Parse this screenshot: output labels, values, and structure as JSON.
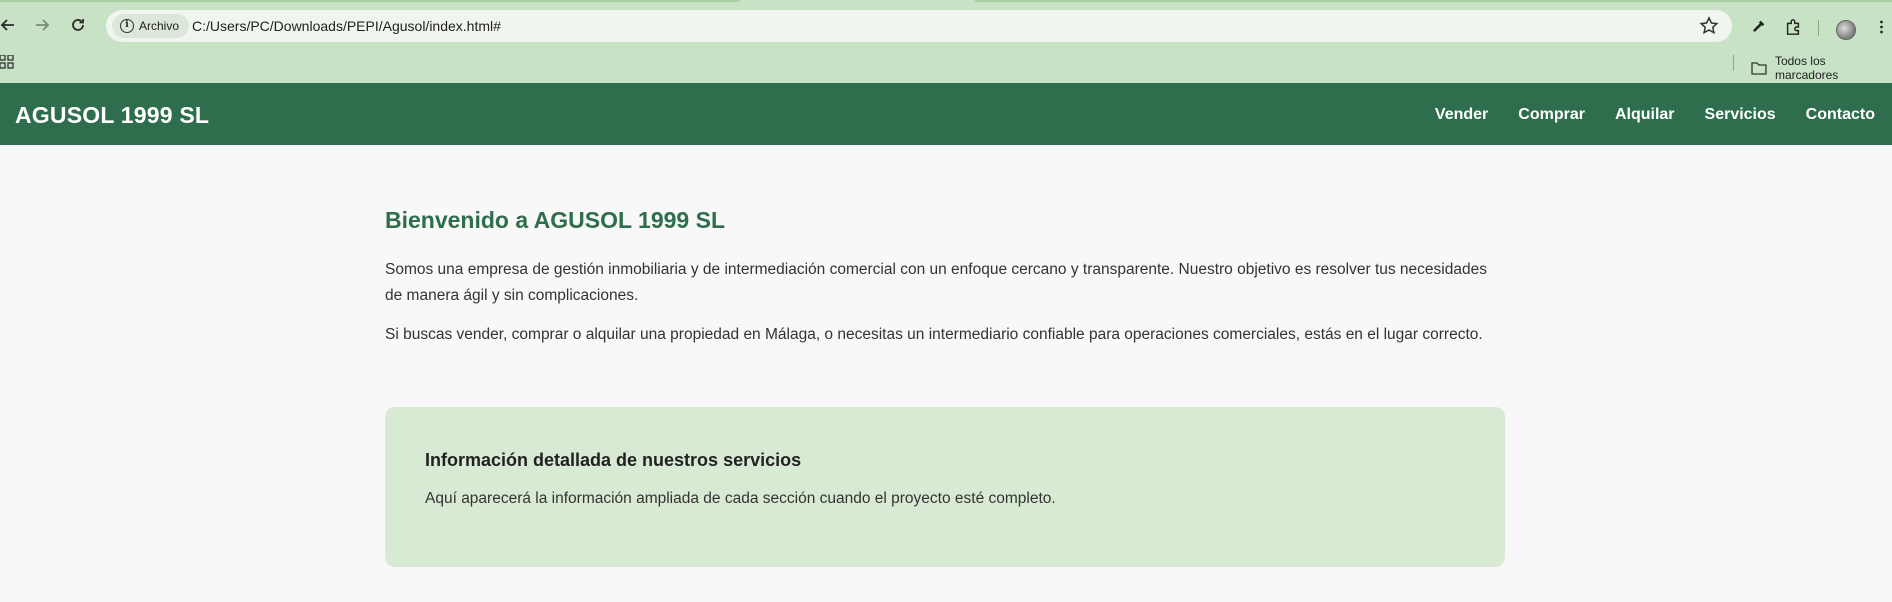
{
  "browser": {
    "url": "C:/Users/PC/Downloads/PEPI/Agusol/index.html#",
    "site_chip_label": "Archivo",
    "bookmarks_folder_label": "Todos los marcadores"
  },
  "header": {
    "brand": "AGUSOL 1999 SL",
    "nav": [
      "Vender",
      "Comprar",
      "Alquilar",
      "Servicios",
      "Contacto"
    ]
  },
  "main": {
    "title": "Bienvenido a AGUSOL 1999 SL",
    "paragraph1": "Somos una empresa de gestión inmobiliaria y de intermediación comercial con un enfoque cercano y transparente. Nuestro objetivo es resolver tus necesidades de manera ágil y sin complicaciones.",
    "paragraph2": "Si buscas vender, comprar o alquilar una propiedad en Málaga, o necesitas un intermediario confiable para operaciones comerciales, estás en el lugar correcto.",
    "info_box": {
      "title": "Información detallada de nuestros servicios",
      "text": "Aquí aparecerá la información ampliada de cada sección cuando el proyecto esté completo."
    }
  },
  "colors": {
    "chrome_bg": "#c8e2c6",
    "header_bg": "#2e6e4c",
    "accent_text": "#2e6e4c",
    "info_box_bg": "#d8ead3"
  }
}
